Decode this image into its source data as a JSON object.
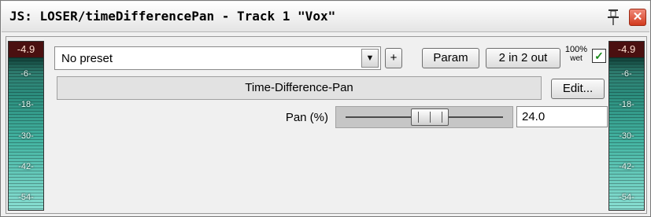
{
  "window": {
    "title": "JS: LOSER/timeDifferencePan - Track 1 \"Vox\"",
    "close_glyph": "✕"
  },
  "meters": {
    "left": {
      "peak": "-4.9",
      "ticks": [
        "-6-",
        "-18-",
        "-30-",
        "-42-",
        "-54-"
      ]
    },
    "right": {
      "peak": "-4.9",
      "ticks": [
        "-6-",
        "-18-",
        "-30-",
        "-42-",
        "-54-"
      ]
    }
  },
  "toolbar": {
    "preset_value": "No preset",
    "dropdown_glyph": "▼",
    "add_label": "+",
    "param_label": "Param",
    "io_label": "2 in 2 out",
    "wet_pct": "100%",
    "wet_label": "wet",
    "enabled": true,
    "check_glyph": "✓"
  },
  "plugin": {
    "name": "Time-Difference-Pan",
    "edit_label": "Edit..."
  },
  "params": [
    {
      "label": "Pan (%)",
      "value": "24.0",
      "slider_fraction": 0.53
    }
  ],
  "colors": {
    "close": "#d23a1e",
    "meter_peak_bg": "#4a1010",
    "meter_bar": "#44b4a2",
    "check": "#1a8a1a"
  }
}
